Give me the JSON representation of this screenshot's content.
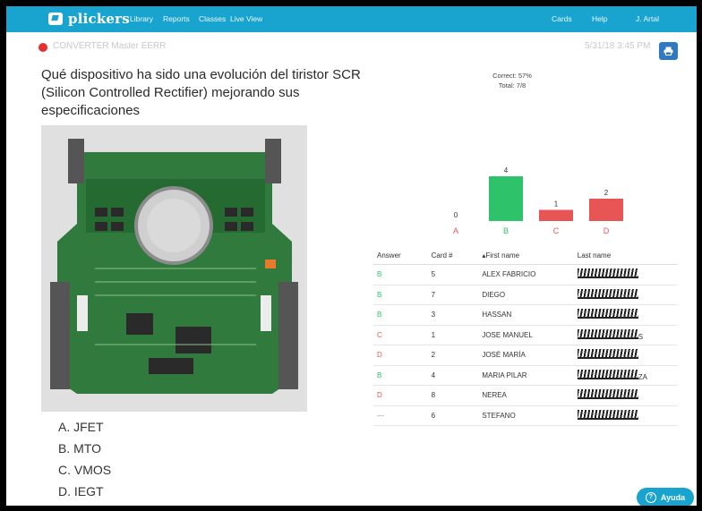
{
  "topbar": {
    "brand": "plickers",
    "nav": [
      "Library",
      "Reports",
      "Classes",
      "Live View"
    ],
    "right": [
      "Cards",
      "Help",
      "J. Artal"
    ]
  },
  "report": {
    "name": "CONVERTER Master EERR",
    "timestamp": "5/31/18 3:45 PM"
  },
  "question": "Qué dispositivo ha sido una evolución del tiristor SCR (Silicon Controlled Rectifier) mejorando sus especificaciones",
  "choices": [
    {
      "letter": "A.",
      "text": "JFET"
    },
    {
      "letter": "B.",
      "text": "MTO"
    },
    {
      "letter": "C.",
      "text": "VMOS"
    },
    {
      "letter": "D.",
      "text": "IEGT"
    }
  ],
  "summary": {
    "correct": "Correct: 57%",
    "total": "Total: 7/8"
  },
  "chart_data": {
    "type": "bar",
    "categories": [
      "A",
      "B",
      "C",
      "D"
    ],
    "values": [
      0,
      4,
      1,
      2
    ],
    "colors": [
      "#e85555",
      "#2ec36a",
      "#e85555",
      "#e85555"
    ],
    "ylim": [
      0,
      4
    ]
  },
  "table": {
    "headers": [
      "Answer",
      "Card #",
      "▴First name",
      "Last name"
    ],
    "rows": [
      {
        "answer": "B",
        "card": "5",
        "first": "ALEX FABRICIO",
        "tail": ""
      },
      {
        "answer": "B",
        "card": "7",
        "first": "DIEGO",
        "tail": ""
      },
      {
        "answer": "B",
        "card": "3",
        "first": "HASSAN",
        "tail": ""
      },
      {
        "answer": "C",
        "card": "1",
        "first": "JOSE MANUEL",
        "tail": "S"
      },
      {
        "answer": "D",
        "card": "2",
        "first": "JOSÉ MARÍA",
        "tail": ""
      },
      {
        "answer": "B",
        "card": "4",
        "first": "MARIA PILAR",
        "tail": "ZA"
      },
      {
        "answer": "D",
        "card": "8",
        "first": "NEREA",
        "tail": ""
      },
      {
        "answer": "—",
        "card": "6",
        "first": "STEFANO",
        "tail": ""
      }
    ]
  },
  "help": {
    "label": "Ayuda"
  },
  "icons": {
    "print": "print-icon",
    "help": "question-circle-icon"
  }
}
